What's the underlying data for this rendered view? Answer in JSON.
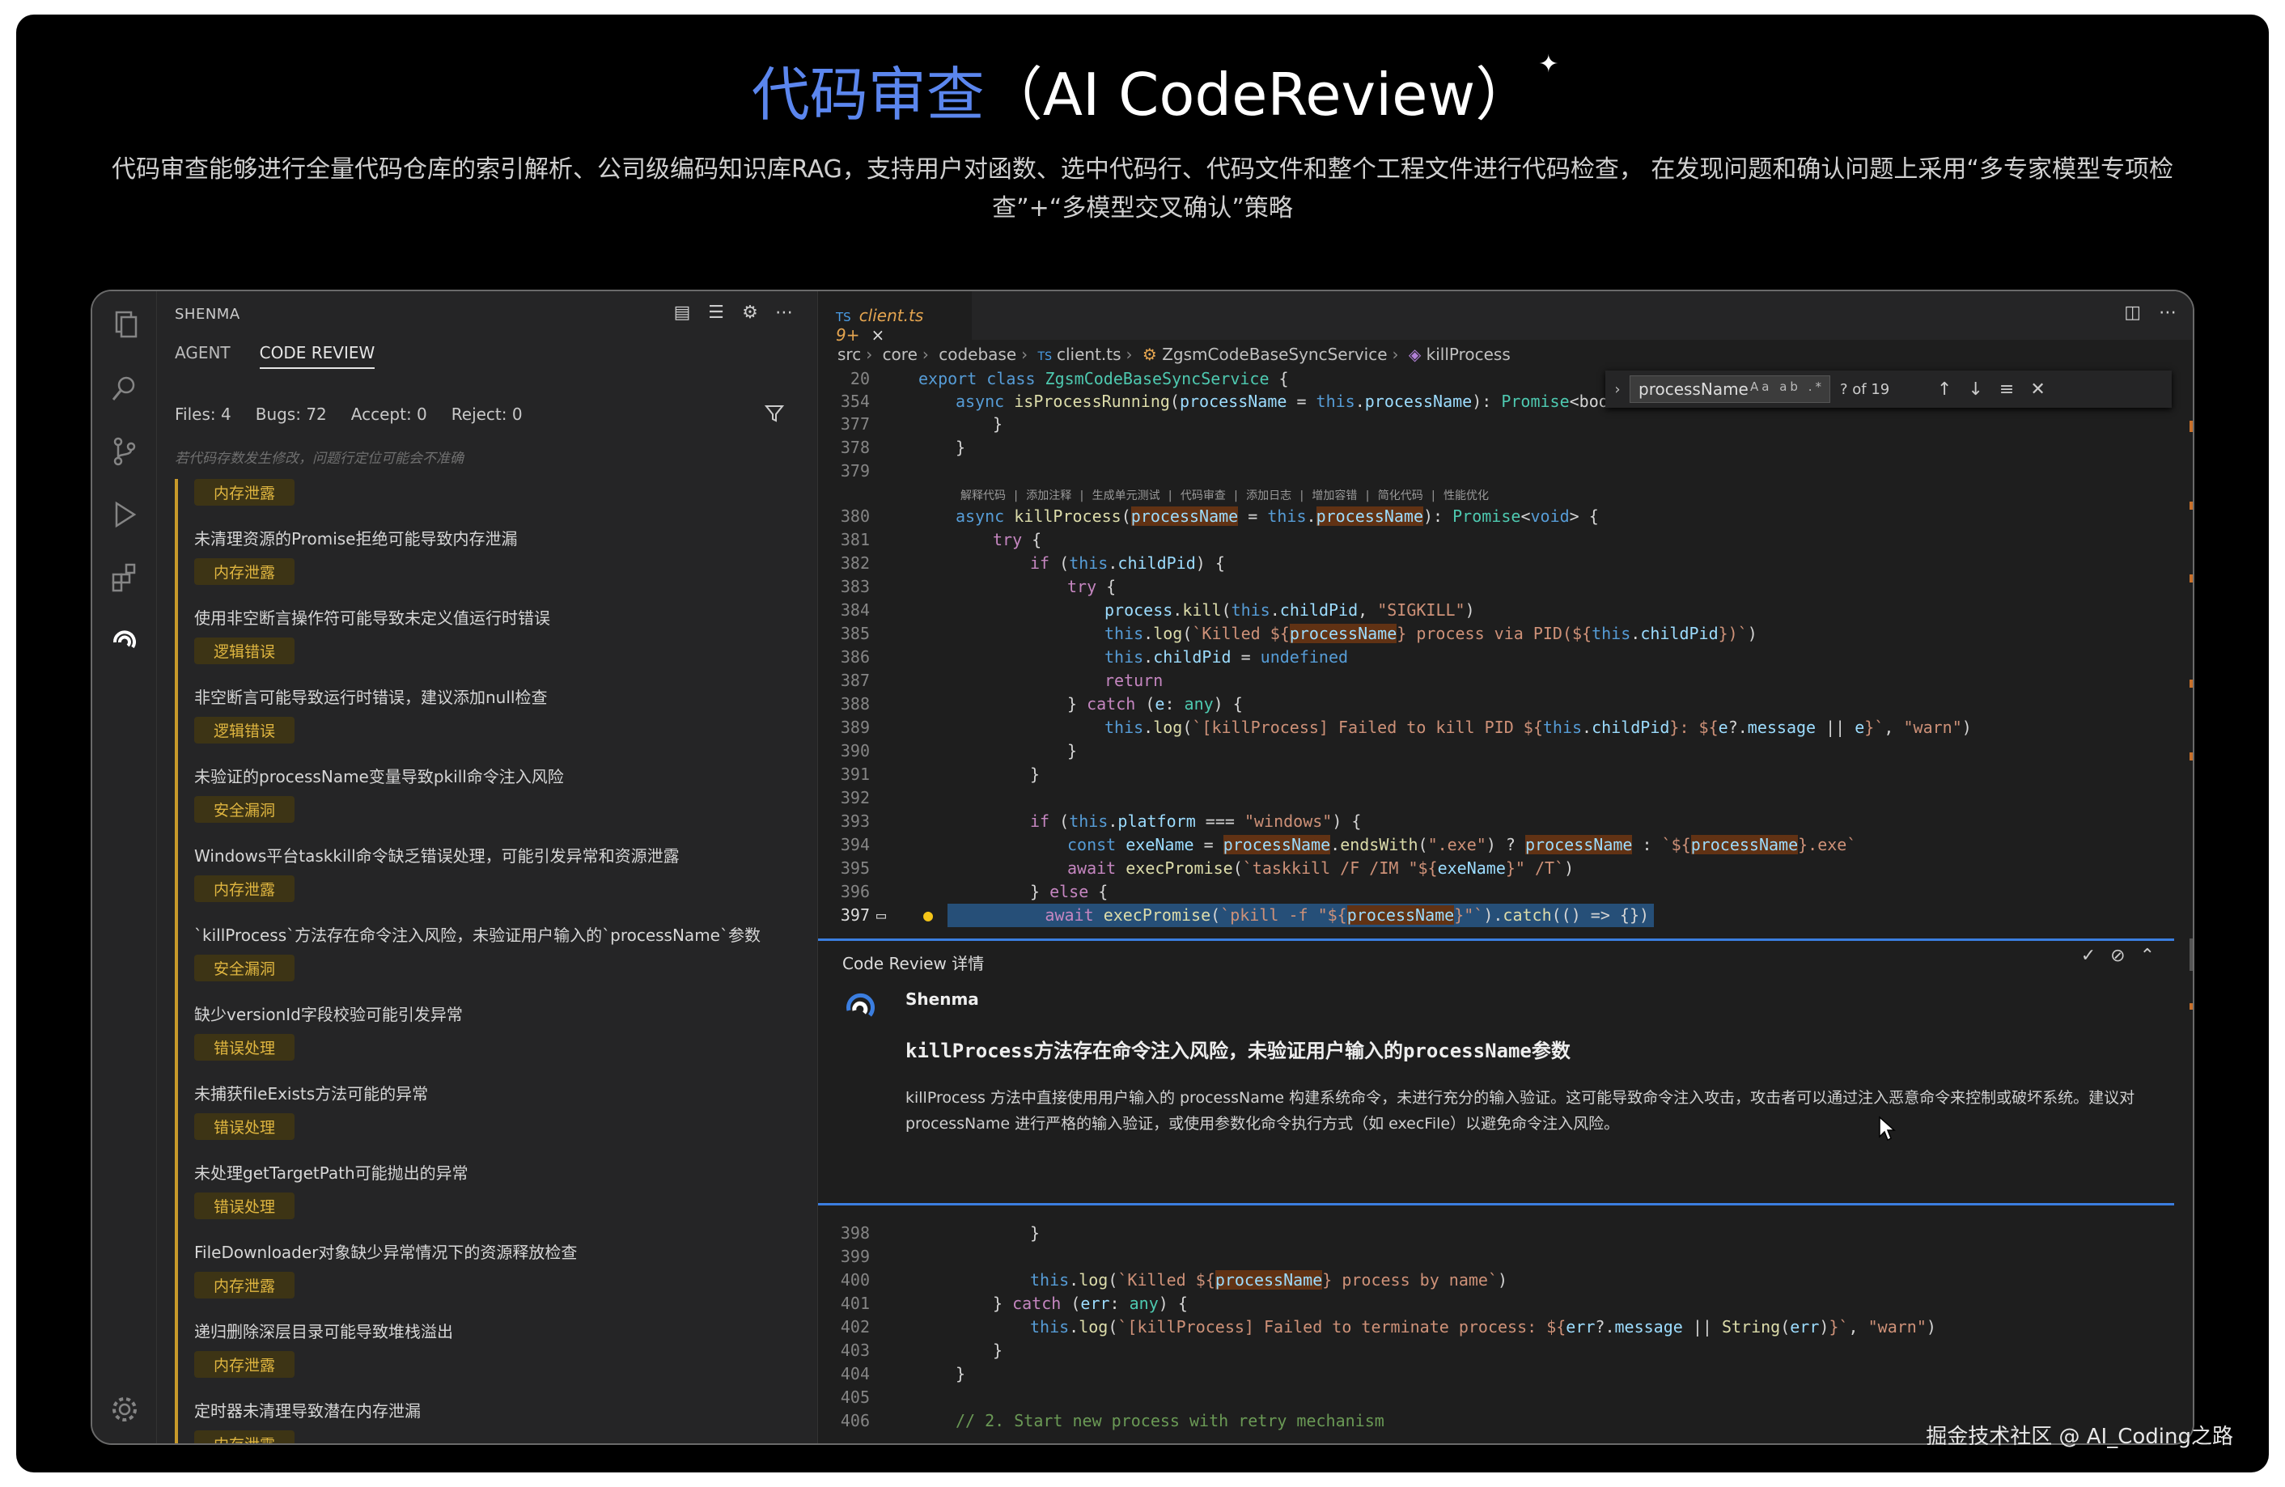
{
  "hero": {
    "title_cn": "代码审查",
    "title_en": "（AI CodeReview）",
    "sparkle": "✦",
    "description": "代码审查能够进行全量代码仓库的索引解析、公司级编码知识库RAG，支持用户对函数、选中代码行、代码文件和整个工程文件进行代码检查， 在发现问题和确认问题上采用“多专家模型专项检查”+“多模型交叉确认”策略"
  },
  "sidebar": {
    "header": "SHENMA",
    "tabs": [
      "AGENT",
      "CODE REVIEW"
    ],
    "active_tab": "CODE REVIEW",
    "stats": {
      "files": "Files: 4",
      "bugs": "Bugs: 72",
      "accept": "Accept: 0",
      "reject": "Reject: 0"
    },
    "note": "若代码存数发生修改，问题行定位可能会不准确",
    "first_badge": "内存泄露",
    "issues": [
      {
        "title": "未清理资源的Promise拒绝可能导致内存泄漏",
        "badge": "内存泄露"
      },
      {
        "title": "使用非空断言操作符可能导致未定义值运行时错误",
        "badge": "逻辑错误"
      },
      {
        "title": "非空断言可能导致运行时错误，建议添加null检查",
        "badge": "逻辑错误"
      },
      {
        "title": "未验证的processName变量导致pkill命令注入风险",
        "badge": "安全漏洞"
      },
      {
        "title": "Windows平台taskkill命令缺乏错误处理，可能引发异常和资源泄露",
        "badge": "内存泄露"
      },
      {
        "title": "`killProcess`方法存在命令注入风险，未验证用户输入的`processName`参数",
        "badge": "安全漏洞"
      },
      {
        "title": "缺少versionId字段校验可能引发异常",
        "badge": "错误处理"
      },
      {
        "title": "未捕获fileExists方法可能的异常",
        "badge": "错误处理"
      },
      {
        "title": "未处理getTargetPath可能抛出的异常",
        "badge": "错误处理"
      },
      {
        "title": "FileDownloader对象缺少异常情况下的资源释放检查",
        "badge": "内存泄露"
      },
      {
        "title": "递归删除深层目录可能导致堆栈溢出",
        "badge": "内存泄露"
      },
      {
        "title": "定时器未清理导致潜在内存泄漏",
        "badge": "内存泄露"
      }
    ]
  },
  "editor": {
    "tab_lang": "TS",
    "tab_name": "client.ts 9+",
    "tab_close": "×",
    "breadcrumb": [
      "src",
      "core",
      "codebase",
      "client.ts",
      "ZgsmCodeBaseSyncService",
      "killProcess"
    ],
    "find": {
      "query": "processName",
      "options": "Aa ab .*",
      "count": "? of 19"
    },
    "codelens": "解释代码 | 添加注释 | 生成单元测试 | 代码审查 | 添加日志 | 增加容错 | 简化代码 | 性能优化",
    "line_numbers_top": [
      "20",
      "354",
      "377",
      "378",
      "379",
      "380",
      "381",
      "382",
      "383",
      "384",
      "385",
      "386",
      "387",
      "388",
      "389",
      "390",
      "391",
      "392",
      "393",
      "394",
      "395",
      "396",
      "397"
    ],
    "line_numbers_bottom": [
      "398",
      "399",
      "400",
      "401",
      "402",
      "403",
      "404",
      "405",
      "406"
    ]
  },
  "review": {
    "header": "Code Review 详情",
    "author": "Shenma",
    "title": "killProcess方法存在命令注入风险，未验证用户输入的processName参数",
    "body": "killProcess 方法中直接使用用户输入的 processName 构建系统命令，未进行充分的输入验证。这可能导致命令注入攻击，攻击者可以通过注入恶意命令来控制或破坏系统。建议对 processName 进行严格的输入验证，或使用参数化命令执行方式（如 execFile）以避免命令注入风险。"
  },
  "watermark": "掘金技术社区 @ AI_Coding之路",
  "colors": {
    "accent": "#3b7ee0",
    "badge_bg": "#3d3415",
    "badge_fg": "#e0b640",
    "title_blue": "#5b86ee"
  }
}
